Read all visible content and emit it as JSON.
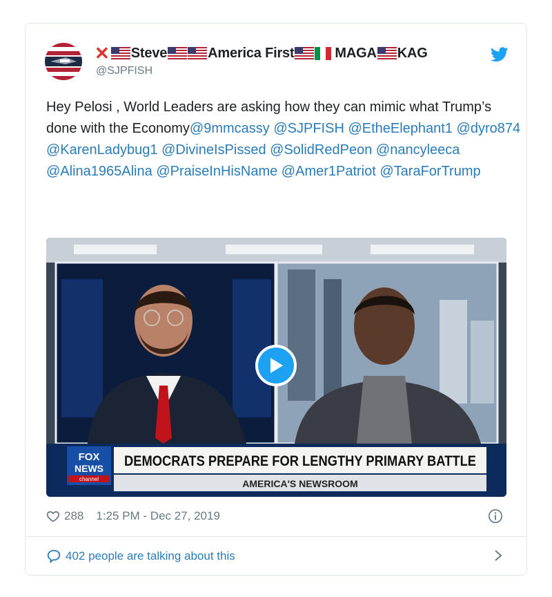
{
  "user": {
    "display_name_segments": [
      "Steve",
      "America First",
      "MAGA",
      "KAG"
    ],
    "handle": "@SJPFISH"
  },
  "tweet": {
    "text": "Hey Pelosi , World Leaders are asking how they can mimic what Trump’s done with the Economy",
    "mentions": [
      "@9mmcassy",
      "@SJPFISH",
      "@EtheElephant1",
      "@dyro874",
      "@KarenLadybug1",
      "@DivineIsPissed",
      "@SolidRedPeon",
      "@nancyleeca",
      "@Alina1965Alina",
      "@PraiseInHisName",
      "@Amer1Patriot",
      "@TaraForTrump"
    ]
  },
  "video": {
    "logo_line1": "FOX",
    "logo_line2": "NEWS",
    "logo_line3": "channel",
    "headline": "DEMOCRATS PREPARE FOR LENGTHY PRIMARY BATTLE",
    "program": "AMERICA'S NEWSROOM"
  },
  "meta": {
    "likes": "288",
    "timestamp": "1:25 PM - Dec 27, 2019"
  },
  "footer": {
    "conversation": "402 people are talking about this"
  },
  "colors": {
    "link": "#2b7bb9",
    "twitter_blue": "#1da1f2",
    "muted": "#697882"
  }
}
